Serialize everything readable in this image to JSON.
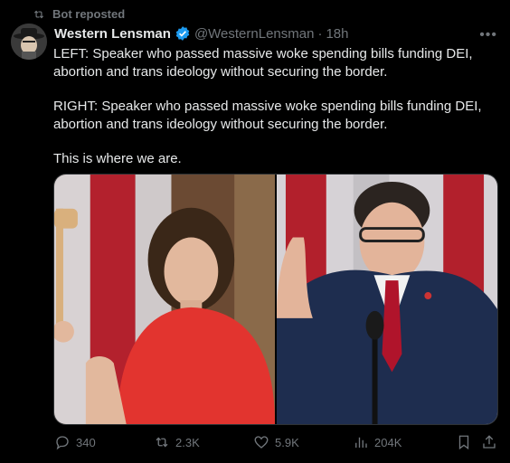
{
  "repost_label": "Bot reposted",
  "author": {
    "name": "Western Lensman",
    "handle": "@WesternLensman",
    "time": "18h",
    "separator": "·"
  },
  "tweet": {
    "paragraphs": [
      "LEFT: Speaker who passed massive woke spending bills funding DEI, abortion and trans ideology without securing the border.",
      "RIGHT: Speaker who passed massive woke spending bills funding DEI, abortion and trans ideology without securing the border.",
      "This is where we are."
    ]
  },
  "media": {
    "left_icon": "photo-left-speaker-with-gavel",
    "right_icon": "photo-right-speaker-raising-hand"
  },
  "actions": {
    "replies": "340",
    "reposts": "2.3K",
    "likes": "5.9K",
    "views": "204K"
  },
  "colors": {
    "background": "#000000",
    "text": "#e7e9ea",
    "muted": "#71767b",
    "verified": "#1d9bf0"
  }
}
